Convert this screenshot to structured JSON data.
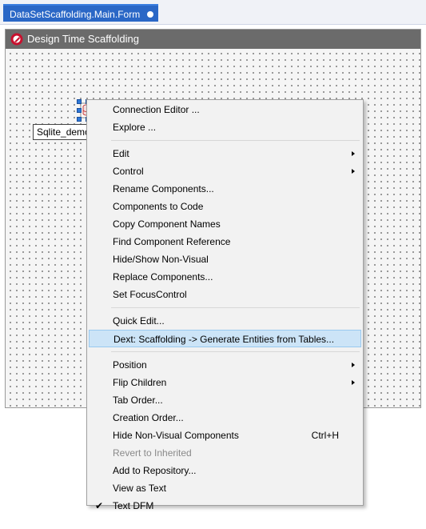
{
  "tab": {
    "title": "DataSetScaffolding.Main.Form"
  },
  "form": {
    "title": "Design Time Scaffolding",
    "component_label": "Sqlite_demo"
  },
  "menu": {
    "items": [
      {
        "label": "Connection Editor ...",
        "submenu": false,
        "shortcut": "",
        "disabled": false,
        "checked": false
      },
      {
        "label": "Explore ...",
        "submenu": false,
        "shortcut": "",
        "disabled": false,
        "checked": false
      },
      {
        "label": "Edit",
        "submenu": true,
        "shortcut": "",
        "disabled": false,
        "checked": false
      },
      {
        "label": "Control",
        "submenu": true,
        "shortcut": "",
        "disabled": false,
        "checked": false
      },
      {
        "label": "Rename Components...",
        "submenu": false,
        "shortcut": "",
        "disabled": false,
        "checked": false
      },
      {
        "label": "Components to Code",
        "submenu": false,
        "shortcut": "",
        "disabled": false,
        "checked": false
      },
      {
        "label": "Copy Component Names",
        "submenu": false,
        "shortcut": "",
        "disabled": false,
        "checked": false
      },
      {
        "label": "Find Component Reference",
        "submenu": false,
        "shortcut": "",
        "disabled": false,
        "checked": false
      },
      {
        "label": "Hide/Show Non-Visual",
        "submenu": false,
        "shortcut": "",
        "disabled": false,
        "checked": false
      },
      {
        "label": "Replace Components...",
        "submenu": false,
        "shortcut": "",
        "disabled": false,
        "checked": false
      },
      {
        "label": "Set FocusControl",
        "submenu": false,
        "shortcut": "",
        "disabled": false,
        "checked": false
      },
      {
        "label": "Quick Edit...",
        "submenu": false,
        "shortcut": "",
        "disabled": false,
        "checked": false
      },
      {
        "label": "Dext: Scaffolding -> Generate Entities from Tables...",
        "submenu": false,
        "shortcut": "",
        "disabled": false,
        "checked": false,
        "highlighted": true
      },
      {
        "label": "Position",
        "submenu": true,
        "shortcut": "",
        "disabled": false,
        "checked": false
      },
      {
        "label": "Flip Children",
        "submenu": true,
        "shortcut": "",
        "disabled": false,
        "checked": false
      },
      {
        "label": "Tab Order...",
        "submenu": false,
        "shortcut": "",
        "disabled": false,
        "checked": false
      },
      {
        "label": "Creation Order...",
        "submenu": false,
        "shortcut": "",
        "disabled": false,
        "checked": false
      },
      {
        "label": "Hide Non-Visual Components",
        "submenu": false,
        "shortcut": "Ctrl+H",
        "disabled": false,
        "checked": false
      },
      {
        "label": "Revert to Inherited",
        "submenu": false,
        "shortcut": "",
        "disabled": true,
        "checked": false
      },
      {
        "label": "Add to Repository...",
        "submenu": false,
        "shortcut": "",
        "disabled": false,
        "checked": false
      },
      {
        "label": "View as Text",
        "submenu": false,
        "shortcut": "",
        "disabled": false,
        "checked": false
      },
      {
        "label": "Text DFM",
        "submenu": false,
        "shortcut": "",
        "disabled": false,
        "checked": true
      }
    ],
    "check_glyph": "✔"
  },
  "colors": {
    "tab_active": "#2a67c6",
    "titlebar": "#6b6b6b",
    "menu_highlight": "#cce4f7",
    "selection_handle": "#2f78d7"
  }
}
